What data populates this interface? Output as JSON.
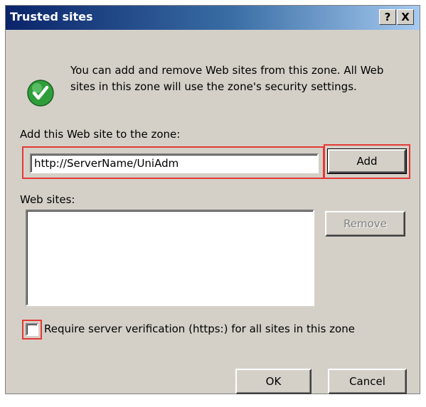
{
  "window": {
    "title": "Trusted sites",
    "help_button": "?",
    "close_button": "X"
  },
  "info": {
    "icon": "checkmark-icon",
    "text": "You can add and remove Web sites from this zone. All Web sites in this zone will use the zone's security settings."
  },
  "add_site": {
    "label": "Add this Web site to the zone:",
    "value": "http://ServerName/UniAdm",
    "button": "Add"
  },
  "web_sites": {
    "label": "Web sites:",
    "items": [],
    "remove_button": "Remove"
  },
  "https_option": {
    "label": "Require server verification (https:) for all sites in this zone",
    "checked": false
  },
  "footer": {
    "ok_button": "OK",
    "cancel_button": "Cancel"
  },
  "colors": {
    "titlebar_start": "#0a246a",
    "titlebar_end": "#a6caf0",
    "dialog_bg": "#d4d0c8",
    "highlight_frame": "#e53935",
    "check_green": "#2e9e3a"
  }
}
